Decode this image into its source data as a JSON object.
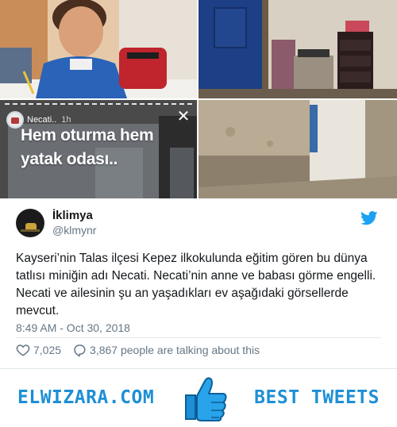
{
  "story": {
    "username": "Necati..",
    "time": "1h",
    "caption": "Hem oturma hem yatak odası.."
  },
  "tweet": {
    "display_name": "İklimya",
    "handle": "@klmynr",
    "text": "Kayseri’nin Talas ilçesi Kepez ilkokulunda eğitim gören bu dünya tatlısı miniğin adı Necati. Necati’nin anne ve babası görme engelli. Necati ve ailesinin şu an yaşadıkları ev aşağıdaki görsellerde mevcut.",
    "timestamp": "8:49 AM - Oct 30, 2018",
    "likes": "7,025",
    "talking": "3,867 people are talking about this"
  },
  "banner": {
    "left_text": "ELWIZARA.COM",
    "right_text": "BEST TWEETS"
  },
  "colors": {
    "twitter_blue": "#1da1f2",
    "banner_blue": "#1d8fd6",
    "secondary_text": "#657786"
  },
  "icons": [
    "close-icon",
    "twitter-bird-icon",
    "heart-icon",
    "comment-icon",
    "thumbs-up-icon"
  ]
}
